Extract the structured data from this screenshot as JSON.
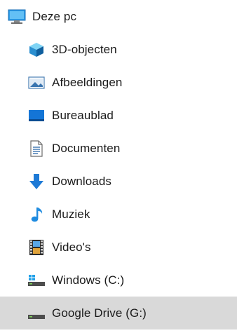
{
  "navigation": {
    "root": {
      "label": "Deze pc",
      "icon": "computer-icon"
    },
    "items": [
      {
        "label": "3D-objecten",
        "icon": "3d-objects-icon"
      },
      {
        "label": "Afbeeldingen",
        "icon": "pictures-icon"
      },
      {
        "label": "Bureaublad",
        "icon": "desktop-icon"
      },
      {
        "label": "Documenten",
        "icon": "documents-icon"
      },
      {
        "label": "Downloads",
        "icon": "downloads-icon"
      },
      {
        "label": "Muziek",
        "icon": "music-icon"
      },
      {
        "label": "Video's",
        "icon": "videos-icon"
      },
      {
        "label": "Windows (C:)",
        "icon": "windows-drive-icon"
      },
      {
        "label": "Google Drive (G:)",
        "icon": "drive-icon",
        "selected": true
      }
    ]
  },
  "colors": {
    "selection_background": "#d9d9d9",
    "accent_blue": "#1e90e8"
  }
}
